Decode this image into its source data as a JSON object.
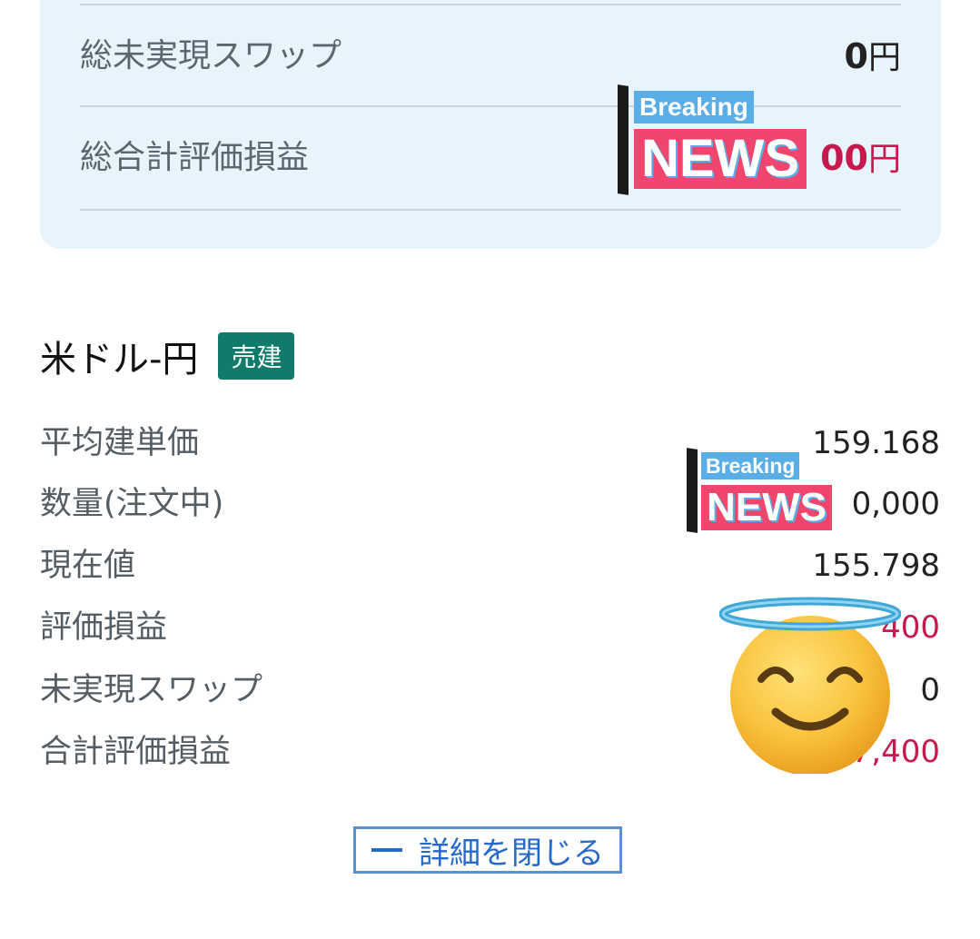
{
  "summary": {
    "unrealized_swap": {
      "label": "総未実現スワップ",
      "value": "0",
      "unit": "円"
    },
    "total_pl": {
      "label": "総合計評価損益",
      "value": "00",
      "unit": "円"
    }
  },
  "position": {
    "pair": "米ドル-円",
    "side": "売建",
    "rows": [
      {
        "label": "平均建単価",
        "value": "159.168"
      },
      {
        "label": "数量(注文中)",
        "value": "0,000"
      },
      {
        "label": "現在値",
        "value": "155.798"
      },
      {
        "label": "評価損益",
        "value": "400"
      },
      {
        "label": "未実現スワップ",
        "value": "0"
      },
      {
        "label": "合計評価損益",
        "value": "7,400"
      }
    ]
  },
  "close_details": {
    "label": "詳細を閉じる"
  },
  "stickers": {
    "breaking": "Breaking",
    "news": "NEWS"
  },
  "colors": {
    "card_bg": "#e8f4fb",
    "negative": "#c8194e",
    "badge": "#107a6b",
    "link": "#2769c8"
  }
}
